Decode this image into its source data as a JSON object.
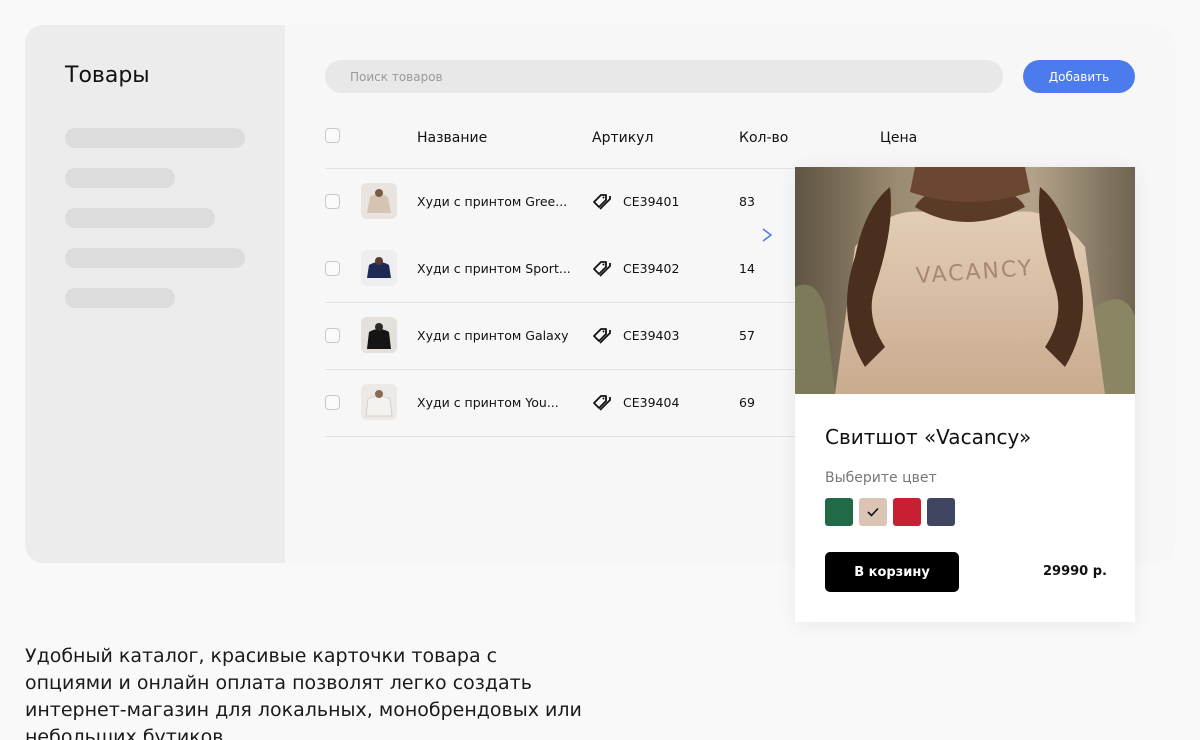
{
  "sidebar": {
    "title": "Товары"
  },
  "toolbar": {
    "search_placeholder": "Поиск товаров",
    "add_label": "Добавить"
  },
  "table": {
    "columns": [
      "Название",
      "Артикул",
      "Кол-во",
      "Цена"
    ],
    "rows": [
      {
        "name": "Худи с принтом Gree...",
        "sku": "CE39401",
        "qty": "83"
      },
      {
        "name": "Худи с принтом Sport...",
        "sku": "CE39402",
        "qty": "14"
      },
      {
        "name": "Худи с принтом Galaxy",
        "sku": "CE39403",
        "qty": "57"
      },
      {
        "name": "Худи с принтом You...",
        "sku": "CE39404",
        "qty": "69"
      }
    ]
  },
  "card": {
    "title": "Свитшот «Vacancy»",
    "photo_print": "VACANCY",
    "color_label": "Выберите цвет",
    "colors": [
      "#1f6b45",
      "#dcc4b4",
      "#c82033",
      "#3e4560"
    ],
    "selected_color_index": 1,
    "cart_label": "В корзину",
    "price": "29990 р."
  },
  "caption": "Удобный каталог, красивые карточки товара с опциями и онлайн оплата позволят легко создать интернет-магазин для локальных, монобрендовых или небольших бутиков"
}
